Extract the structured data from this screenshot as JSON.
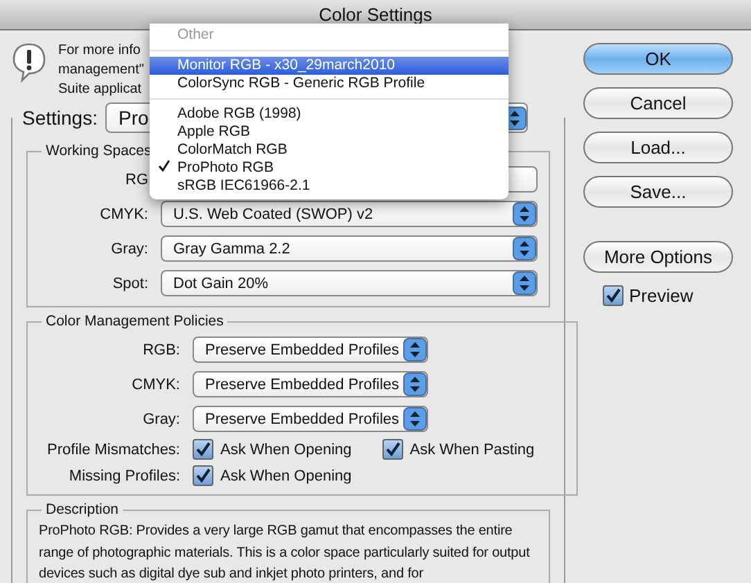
{
  "window": {
    "title": "Color Settings"
  },
  "info": {
    "lines": [
      "For more info",
      "management\"",
      "Suite applicat"
    ]
  },
  "settings": {
    "label": "Settings:",
    "value": "Pro"
  },
  "working_spaces": {
    "title": "Working Spaces",
    "rows": [
      {
        "label": "RG"
      },
      {
        "label": "CMYK:",
        "value": "U.S. Web Coated (SWOP) v2"
      },
      {
        "label": "Gray:",
        "value": "Gray Gamma 2.2"
      },
      {
        "label": "Spot:",
        "value": "Dot Gain 20%"
      }
    ]
  },
  "policies": {
    "title": "Color Management Policies",
    "rows": [
      {
        "label": "RGB:",
        "value": "Preserve Embedded Profiles"
      },
      {
        "label": "CMYK:",
        "value": "Preserve Embedded Profiles"
      },
      {
        "label": "Gray:",
        "value": "Preserve Embedded Profiles"
      }
    ],
    "checks": [
      {
        "label": "Profile Mismatches:",
        "options": [
          {
            "label": "Ask When Opening",
            "checked": true
          },
          {
            "label": "Ask When Pasting",
            "checked": true
          }
        ]
      },
      {
        "label": "Missing Profiles:",
        "options": [
          {
            "label": "Ask When Opening",
            "checked": true
          }
        ]
      }
    ]
  },
  "description": {
    "title": "Description",
    "text": "ProPhoto RGB:  Provides a very large RGB gamut that encompasses the entire range of photographic materials. This is a color space particularly suited for output devices such as digital dye sub and inkjet photo printers, and for"
  },
  "buttons": [
    {
      "label": "OK",
      "default": true
    },
    {
      "label": "Cancel",
      "default": false
    },
    {
      "label": "Load...",
      "default": false
    },
    {
      "label": "Save...",
      "default": false
    },
    {
      "label": "More Options",
      "default": false
    }
  ],
  "preview": {
    "label": "Preview",
    "checked": true
  },
  "menu": {
    "items": [
      {
        "kind": "header",
        "label": "Other"
      },
      {
        "kind": "separator"
      },
      {
        "kind": "item",
        "label": "Monitor RGB - x30_29march2010",
        "selected": true,
        "checked": false
      },
      {
        "kind": "item",
        "label": "ColorSync RGB - Generic RGB Profile",
        "selected": false,
        "checked": false
      },
      {
        "kind": "separator"
      },
      {
        "kind": "item",
        "label": "Adobe RGB (1998)",
        "selected": false,
        "checked": false
      },
      {
        "kind": "item",
        "label": "Apple RGB",
        "selected": false,
        "checked": false
      },
      {
        "kind": "item",
        "label": "ColorMatch RGB",
        "selected": false,
        "checked": false
      },
      {
        "kind": "item",
        "label": "ProPhoto RGB",
        "selected": false,
        "checked": true
      },
      {
        "kind": "item",
        "label": "sRGB IEC61966-2.1",
        "selected": false,
        "checked": false
      }
    ]
  }
}
